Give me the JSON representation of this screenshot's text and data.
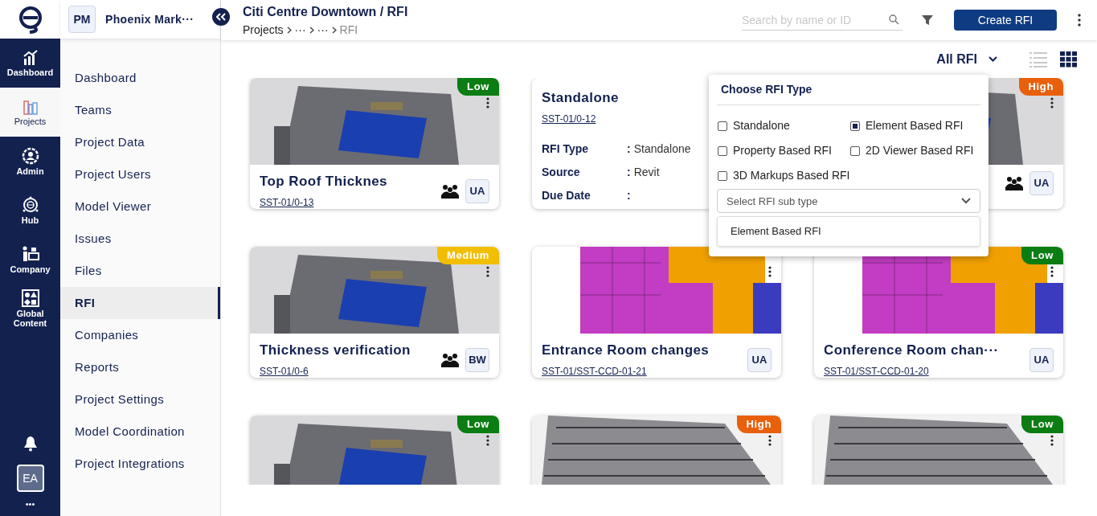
{
  "rail": {
    "items": [
      {
        "label": "Dashboard",
        "selected": false
      },
      {
        "label": "Projects",
        "selected": true
      },
      {
        "label": "Admin",
        "selected": false
      },
      {
        "label": "Hub",
        "selected": false
      },
      {
        "label": "Company",
        "selected": false
      },
      {
        "label": "Global Content",
        "selected": false
      }
    ],
    "avatar": "EA",
    "more": "•••"
  },
  "project": {
    "initials": "PM",
    "name": "Phoenix Mark···"
  },
  "nav": [
    {
      "label": "Dashboard",
      "selected": false
    },
    {
      "label": "Teams",
      "selected": false
    },
    {
      "label": "Project Data",
      "selected": false
    },
    {
      "label": "Project Users",
      "selected": false
    },
    {
      "label": "Model Viewer",
      "selected": false
    },
    {
      "label": "Issues",
      "selected": false
    },
    {
      "label": "Files",
      "selected": false
    },
    {
      "label": "RFI",
      "selected": true
    },
    {
      "label": "Companies",
      "selected": false
    },
    {
      "label": "Reports",
      "selected": false
    },
    {
      "label": "Project Settings",
      "selected": false
    },
    {
      "label": "Model Coordination",
      "selected": false
    },
    {
      "label": "Project Integrations",
      "selected": false
    }
  ],
  "header": {
    "title": "Citi Centre Downtown / RFI",
    "breadcrumb": [
      "Projects",
      "···",
      "···",
      "RFI"
    ],
    "search": {
      "placeholder": "Search by name or ID"
    },
    "create_button": "Create RFI"
  },
  "filter": {
    "value": "All RFI"
  },
  "views": [
    {
      "kind": "list",
      "selected": false
    },
    {
      "kind": "grid",
      "selected": true
    }
  ],
  "cards": [
    {
      "kind": "image",
      "priority": {
        "label": "Low",
        "color": "#0b7d12"
      },
      "title": "Top Roof Thicknes",
      "id": "SST-01/0-13",
      "team": true,
      "assignee": "UA"
    },
    {
      "kind": "info",
      "title": "Standalone",
      "id": "SST-01/0-12",
      "fields": [
        {
          "label": "RFI Type",
          "separator": ":",
          "value": "Standalone"
        },
        {
          "label": "Source",
          "separator": ":",
          "value": "Revit"
        },
        {
          "label": "Due Date",
          "separator": ":"
        }
      ]
    },
    {
      "kind": "image",
      "priority": {
        "label": "High",
        "color": "#e8600b"
      },
      "team": true,
      "assignee": "UA"
    },
    {
      "kind": "image",
      "priority": {
        "label": "Medium",
        "color": "#f2be00"
      },
      "title": "Thickness verification",
      "id": "SST-01/0-6",
      "team": true,
      "assignee": "BW"
    },
    {
      "kind": "image",
      "title": "Entrance Room changes",
      "id": "SST-01/SST-CCD-01-21",
      "team": false,
      "assignee": "UA"
    },
    {
      "kind": "image",
      "priority": {
        "label": "Low",
        "color": "#0b7d12"
      },
      "title": "Conference Room chan···",
      "id": "SST-01/SST-CCD-01-20",
      "team": false,
      "assignee": "UA"
    },
    {
      "kind": "image",
      "priority": {
        "label": "Low",
        "color": "#0b7d12"
      }
    },
    {
      "kind": "image",
      "priority": {
        "label": "High",
        "color": "#e8600b"
      }
    },
    {
      "kind": "image",
      "priority": {
        "label": "Low",
        "color": "#0b7d12"
      }
    }
  ],
  "popup": {
    "title": "Choose RFI Type",
    "options": [
      {
        "label": "Standalone",
        "checked": false
      },
      {
        "label": "Element Based RFI",
        "checked": true
      },
      {
        "label": "Property Based RFI",
        "checked": false
      },
      {
        "label": "2D Viewer Based RFI",
        "checked": false
      },
      {
        "label": "3D Markups Based RFI",
        "checked": false
      }
    ],
    "subtype": {
      "placeholder": "Select RFI sub type"
    },
    "suggestions": [
      "Element Based RFI"
    ]
  }
}
